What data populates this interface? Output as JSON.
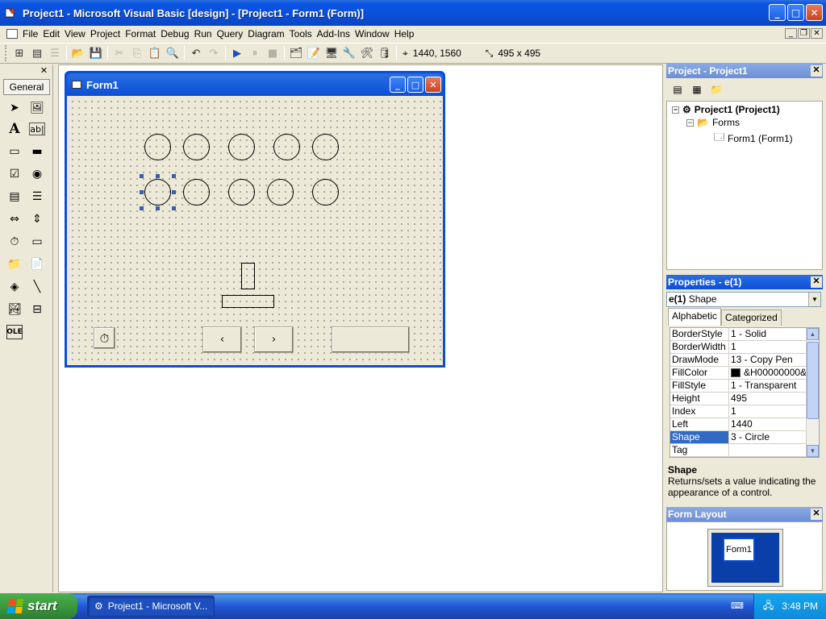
{
  "window": {
    "title": "Project1 - Microsoft Visual Basic [design] - [Project1 - Form1 (Form)]"
  },
  "menu": [
    "File",
    "Edit",
    "View",
    "Project",
    "Format",
    "Debug",
    "Run",
    "Query",
    "Diagram",
    "Tools",
    "Add-Ins",
    "Window",
    "Help"
  ],
  "toolbar": {
    "position": "1440, 1560",
    "size": "495 x 495"
  },
  "toolbox": {
    "tab_label": "General"
  },
  "form": {
    "title": "Form1",
    "prev_button": "‹",
    "next_button": "›"
  },
  "project_panel": {
    "title": "Project - Project1",
    "tree": [
      {
        "label": "Project1 (Project1)",
        "bold": true
      },
      {
        "label": "Forms",
        "bold": false
      },
      {
        "label": "Form1 (Form1)",
        "bold": false
      }
    ]
  },
  "properties_panel": {
    "title": "Properties - e(1)",
    "object_name": "e(1)",
    "object_type": "Shape",
    "tabs": [
      "Alphabetic",
      "Categorized"
    ],
    "rows": [
      {
        "name": "BorderStyle",
        "value": "1 - Solid"
      },
      {
        "name": "BorderWidth",
        "value": "1"
      },
      {
        "name": "DrawMode",
        "value": "13 - Copy Pen"
      },
      {
        "name": "FillColor",
        "value": "&H00000000&",
        "swatch": "#000000"
      },
      {
        "name": "FillStyle",
        "value": "1 - Transparent"
      },
      {
        "name": "Height",
        "value": "495"
      },
      {
        "name": "Index",
        "value": "1"
      },
      {
        "name": "Left",
        "value": "1440"
      },
      {
        "name": "Shape",
        "value": "3 - Circle",
        "selected": true
      },
      {
        "name": "Tag",
        "value": ""
      }
    ],
    "description_title": "Shape",
    "description_text": "Returns/sets a value indicating the appearance of a control."
  },
  "form_layout_panel": {
    "title": "Form Layout",
    "form_label": "Form1"
  },
  "taskbar": {
    "start_label": "start",
    "task_label": "Project1 - Microsoft V...",
    "clock": "3:48 PM"
  },
  "colors": {
    "xp_blue": "#0a4fd8",
    "selection": "#316ac5",
    "face": "#ece9d8"
  }
}
